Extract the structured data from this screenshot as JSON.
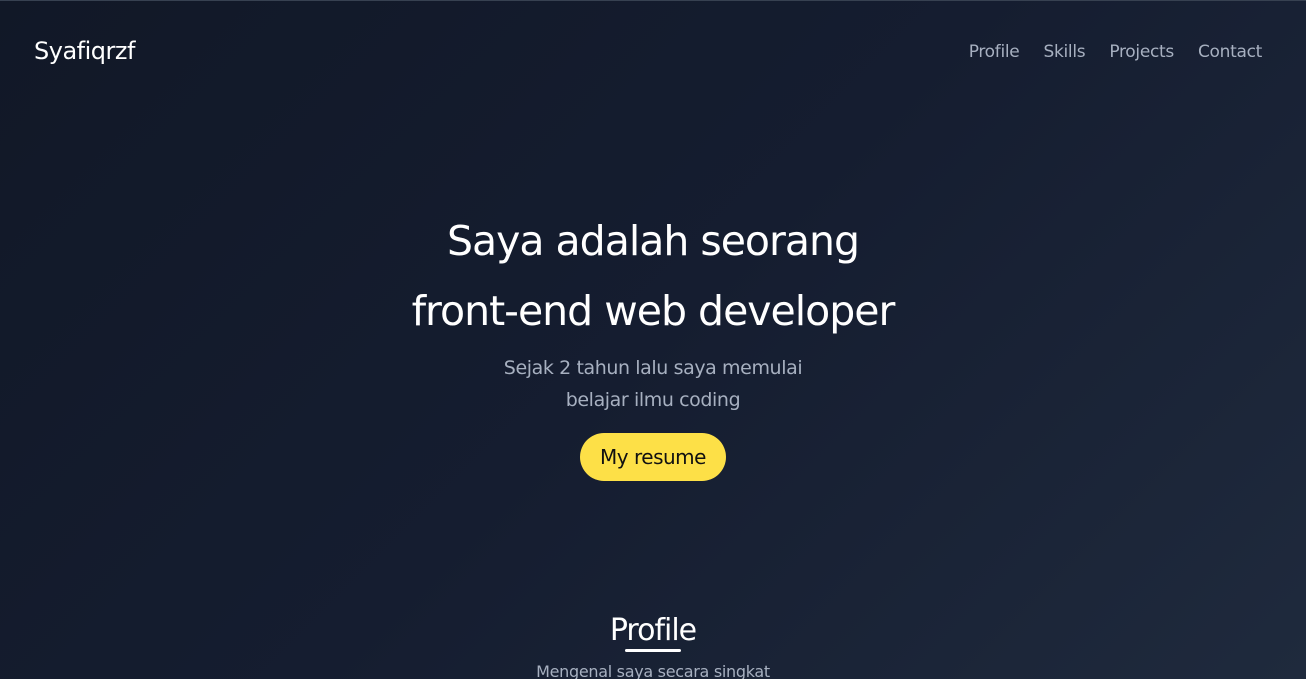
{
  "navbar": {
    "brand": "Syafiqrzf",
    "links": [
      {
        "label": "Profile"
      },
      {
        "label": "Skills"
      },
      {
        "label": "Projects"
      },
      {
        "label": "Contact"
      }
    ]
  },
  "hero": {
    "title_line1": "Saya adalah seorang",
    "title_line2": "front-end web developer",
    "sub_line1": "Sejak 2 tahun lalu saya memulai",
    "sub_line2": "belajar ilmu coding",
    "button_label": "My resume"
  },
  "profile_section": {
    "title": "Profile",
    "subtitle": "Mengenal saya secara singkat"
  },
  "colors": {
    "background": "#111827",
    "accent": "#fde047",
    "muted_text": "#a7b0c0",
    "text": "#ffffff"
  }
}
